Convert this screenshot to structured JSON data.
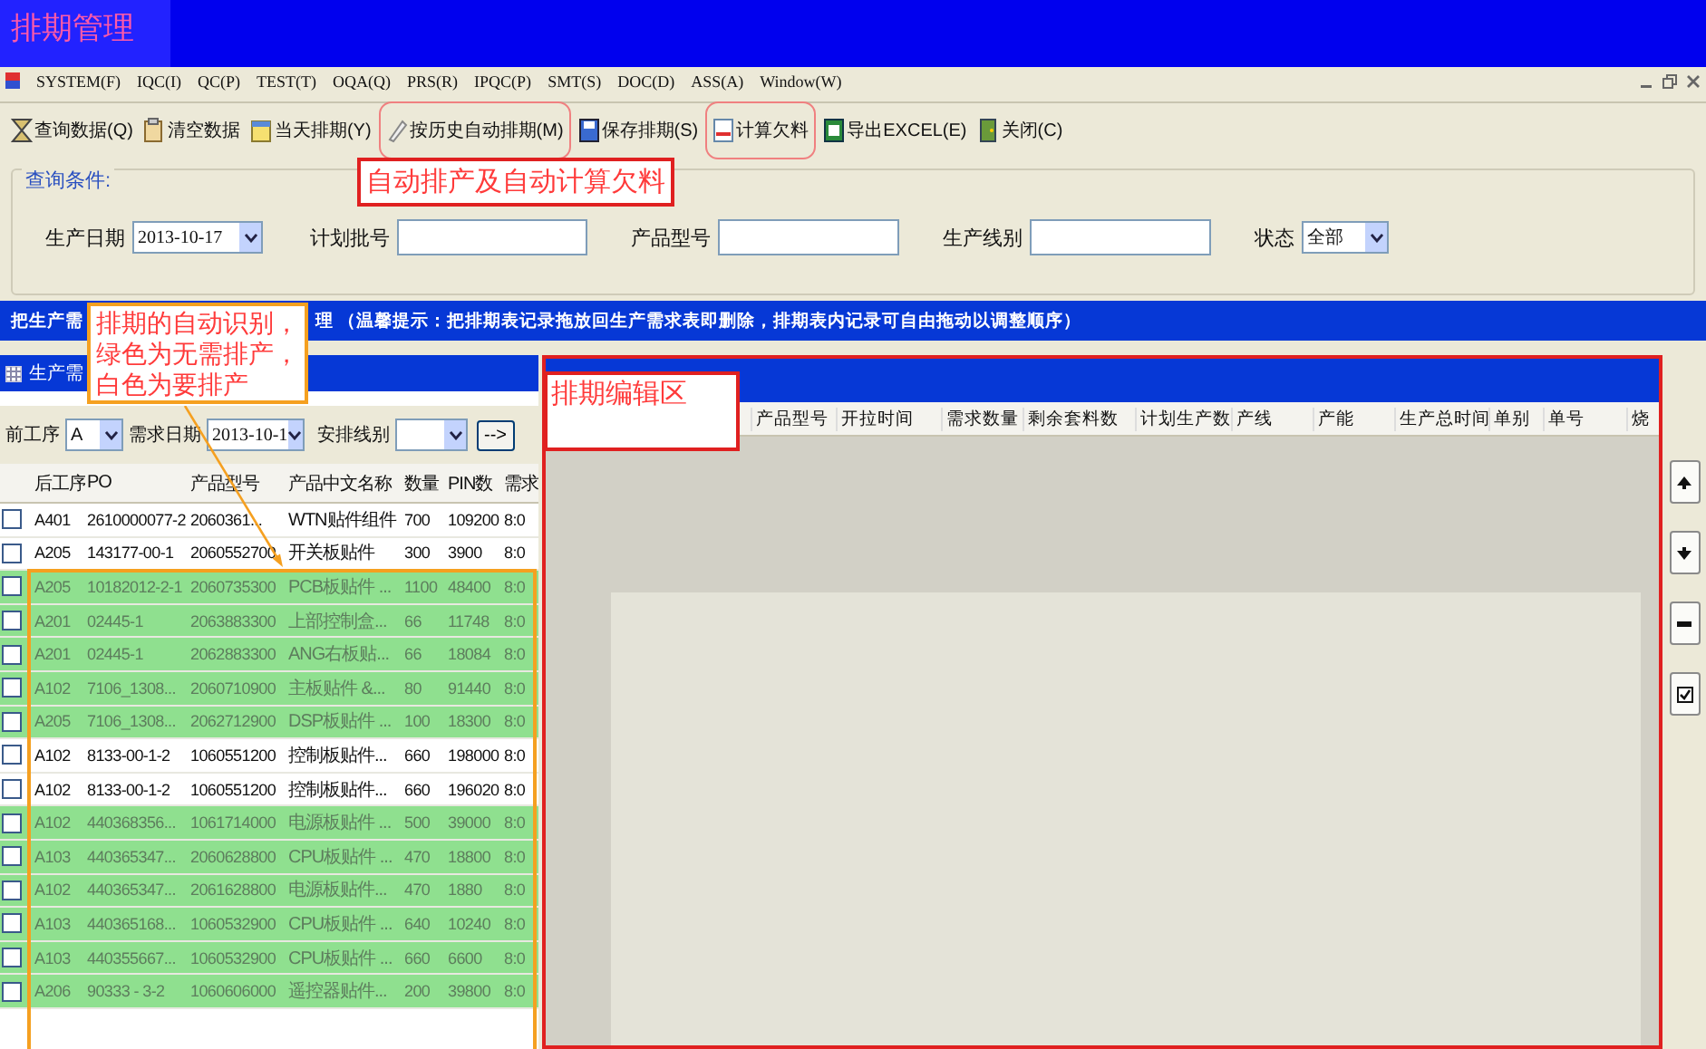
{
  "window": {
    "title": "排期管理"
  },
  "menu": [
    "SYSTEM(F)",
    "IQC(I)",
    "QC(P)",
    "TEST(T)",
    "OQA(Q)",
    "PRS(R)",
    "IPQC(P)",
    "SMT(S)",
    "DOC(D)",
    "ASS(A)",
    "Window(W)"
  ],
  "toolbar": [
    {
      "label": "查询数据(Q)",
      "highlighted": false
    },
    {
      "label": "清空数据",
      "highlighted": false
    },
    {
      "label": "当天排期(Y)",
      "highlighted": false
    },
    {
      "label": "按历史自动排期(M)",
      "highlighted": true
    },
    {
      "label": "保存排期(S)",
      "highlighted": false
    },
    {
      "label": "计算欠料",
      "highlighted": true
    },
    {
      "label": "导出EXCEL(E)",
      "highlighted": false
    },
    {
      "label": "关闭(C)",
      "highlighted": false
    }
  ],
  "query": {
    "legend": "查询条件:",
    "fields": [
      {
        "kind": "date",
        "label": "生产日期",
        "value": "2013-10-17"
      },
      {
        "kind": "text",
        "label": "计划批号"
      },
      {
        "kind": "text",
        "label": "产品型号"
      },
      {
        "kind": "text",
        "label": "生产线别"
      },
      {
        "kind": "select",
        "label": "状态",
        "value": "全部"
      }
    ]
  },
  "notice_bar": {
    "parts": [
      "把生产需",
      "理 （温馨提示：把排期表记录拖放回生产需求表即删除，排期表内记录可自由拖动以调整顺序）"
    ]
  },
  "demand_panel": {
    "title": "生产需",
    "filters": [
      {
        "kind": "select",
        "label": "前工序",
        "value": "A"
      },
      {
        "kind": "date",
        "label": "需求日期",
        "value": "2013-10-1"
      },
      {
        "kind": "select",
        "label": "安排线别"
      }
    ],
    "transfer_button": "-->",
    "columns": [
      "后工序",
      "PO",
      "产品型号",
      "产品中文名称",
      "数量",
      "PIN数",
      "需求"
    ],
    "rows": [
      {
        "checked": false,
        "no_scheduling_needed": false,
        "cells": [
          "A401",
          "2610000077-2",
          "2060361...",
          "WTN贴件组件",
          "700",
          "109200",
          "8:0"
        ]
      },
      {
        "checked": false,
        "no_scheduling_needed": false,
        "cells": [
          "A205",
          "143177-00-1",
          "2060552700",
          "开关板贴件",
          "300",
          "3900",
          "8:0"
        ]
      },
      {
        "checked": false,
        "no_scheduling_needed": true,
        "cells": [
          "A205",
          "10182012-2-1",
          "2060735300",
          "PCB板贴件 ...",
          "1100",
          "48400",
          "8:0"
        ]
      },
      {
        "checked": false,
        "no_scheduling_needed": true,
        "cells": [
          "A201",
          "02445-1",
          "2063883300",
          "上部控制盒...",
          "66",
          "11748",
          "8:0"
        ]
      },
      {
        "checked": false,
        "no_scheduling_needed": true,
        "cells": [
          "A201",
          "02445-1",
          "2062883300",
          "ANG右板贴...",
          "66",
          "18084",
          "8:0"
        ]
      },
      {
        "checked": false,
        "no_scheduling_needed": true,
        "cells": [
          "A102",
          "7106_1308...",
          "2060710900",
          "主板贴件 &...",
          "80",
          "91440",
          "8:0"
        ]
      },
      {
        "checked": false,
        "no_scheduling_needed": true,
        "cells": [
          "A205",
          "7106_1308...",
          "2062712900",
          "DSP板贴件 ...",
          "100",
          "18300",
          "8:0"
        ]
      },
      {
        "checked": false,
        "no_scheduling_needed": false,
        "cells": [
          "A102",
          "8133-00-1-2",
          "1060551200",
          "控制板贴件...",
          "660",
          "198000",
          "8:0"
        ]
      },
      {
        "checked": false,
        "no_scheduling_needed": false,
        "cells": [
          "A102",
          "8133-00-1-2",
          "1060551200",
          "控制板贴件...",
          "660",
          "196020",
          "8:0"
        ]
      },
      {
        "checked": false,
        "no_scheduling_needed": true,
        "cells": [
          "A102",
          "440368356...",
          "1061714000",
          "电源板贴件 ...",
          "500",
          "39000",
          "8:0"
        ]
      },
      {
        "checked": false,
        "no_scheduling_needed": true,
        "cells": [
          "A103",
          "440365347...",
          "2060628800",
          "CPU板贴件 ...",
          "470",
          "18800",
          "8:0"
        ]
      },
      {
        "checked": false,
        "no_scheduling_needed": true,
        "cells": [
          "A102",
          "440365347...",
          "2061628800",
          "电源板贴件...",
          "470",
          "1880",
          "8:0"
        ]
      },
      {
        "checked": false,
        "no_scheduling_needed": true,
        "cells": [
          "A103",
          "440365168...",
          "1060532900",
          "CPU板贴件 ...",
          "640",
          "10240",
          "8:0"
        ]
      },
      {
        "checked": false,
        "no_scheduling_needed": true,
        "cells": [
          "A103",
          "440355667...",
          "1060532900",
          "CPU板贴件 ...",
          "660",
          "6600",
          "8:0"
        ]
      },
      {
        "checked": false,
        "no_scheduling_needed": true,
        "cells": [
          "A206",
          "90333 - 3-2",
          "1060606000",
          "遥控器贴件...",
          "200",
          "39800",
          "8:0"
        ]
      }
    ]
  },
  "schedule_panel": {
    "columns": [
      "产品型号",
      "开拉时间",
      "需求数量",
      "剩余套料数",
      "计划生产数",
      "产线",
      "产能",
      "生产总时间",
      "单别",
      "单号",
      "烧"
    ]
  },
  "annotations": [
    {
      "kind": "callout",
      "text": "自动排产及自动计算欠料"
    },
    {
      "kind": "note",
      "text": "排期的自动识别，绿色为无需排产，白色为要排产"
    },
    {
      "kind": "region",
      "text": "排期编辑区"
    }
  ]
}
